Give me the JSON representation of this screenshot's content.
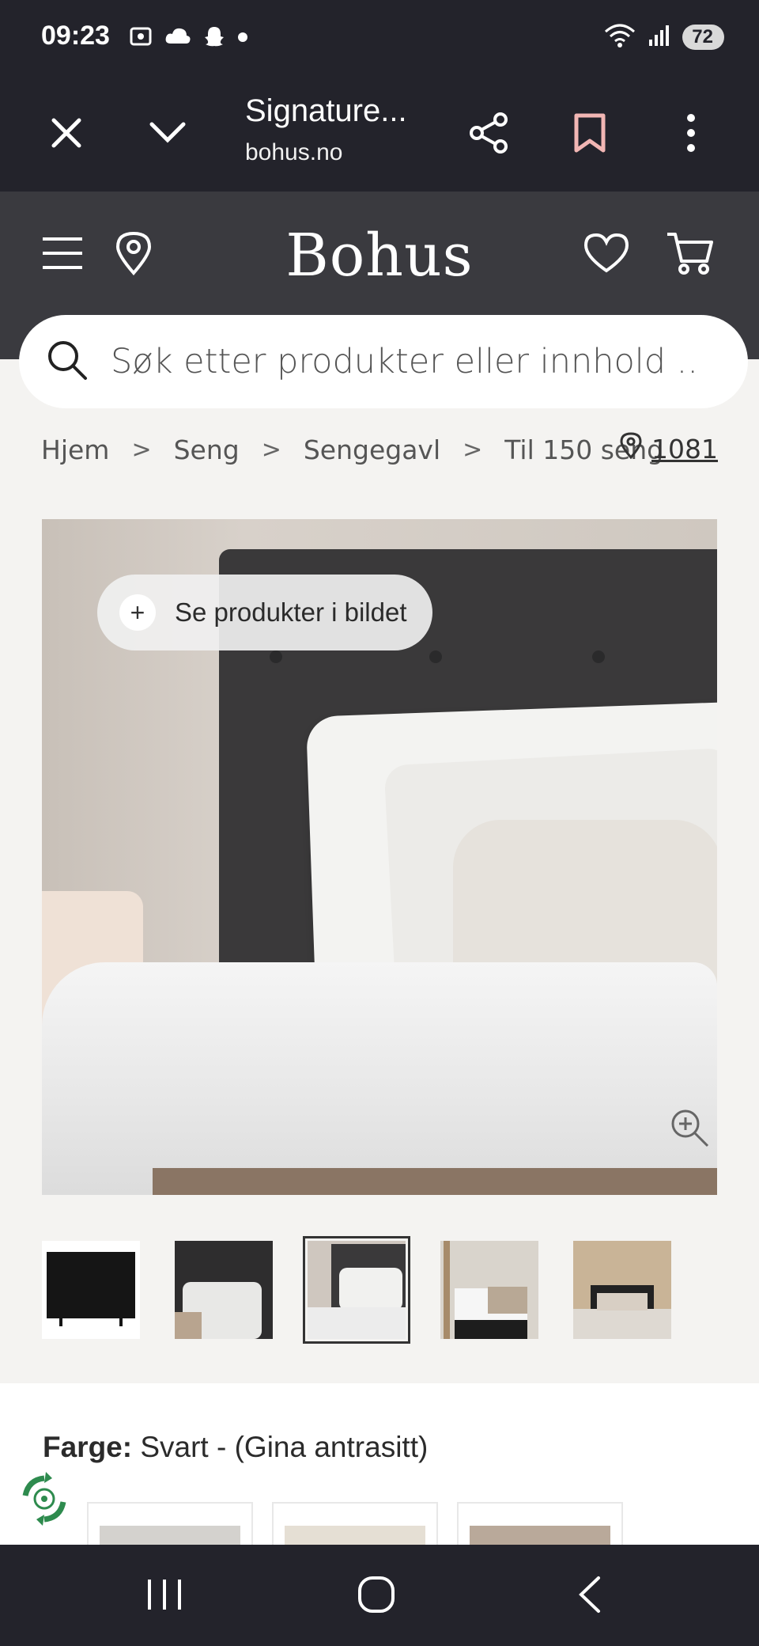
{
  "status_bar": {
    "time": "09:23",
    "left_icons": [
      "screenshot-icon",
      "cloud-icon",
      "snapchat-icon",
      "dot-icon"
    ],
    "right_icons": [
      "wifi-icon",
      "signal-icon"
    ],
    "battery": "72"
  },
  "browser": {
    "title": "Signature...",
    "url": "bohus.no",
    "icons": [
      "close-icon",
      "chevron-down-icon",
      "share-icon",
      "bookmark-icon",
      "more-icon"
    ]
  },
  "site": {
    "logo": "Bohus",
    "search_placeholder": "Søk etter produkter eller innhold .."
  },
  "breadcrumb": {
    "items": [
      "Hjem",
      "Seng",
      "Sengegavl",
      "Til 150 seng"
    ],
    "separator": ">",
    "store_code": "1081"
  },
  "hero": {
    "see_products_label": "Se produkter i bildet",
    "plus": "+"
  },
  "thumbnails": [
    {
      "name": "headboard-front"
    },
    {
      "name": "headboard-closeup"
    },
    {
      "name": "bedroom-pillows",
      "active": true
    },
    {
      "name": "bedroom-white-duvet"
    },
    {
      "name": "bedroom-wide"
    }
  ],
  "color": {
    "label": "Farge:",
    "value": "Svart - (Gina antrasitt)",
    "swatches": [
      "#d4d2ce",
      "#e5dfd4",
      "#b9a99a"
    ]
  },
  "colors": {
    "statusbar_bg": "#23232b",
    "header_bg": "#3a3a3f",
    "bookmark_accent": "#f2b6b4",
    "page_bg": "#f4f3f1"
  }
}
